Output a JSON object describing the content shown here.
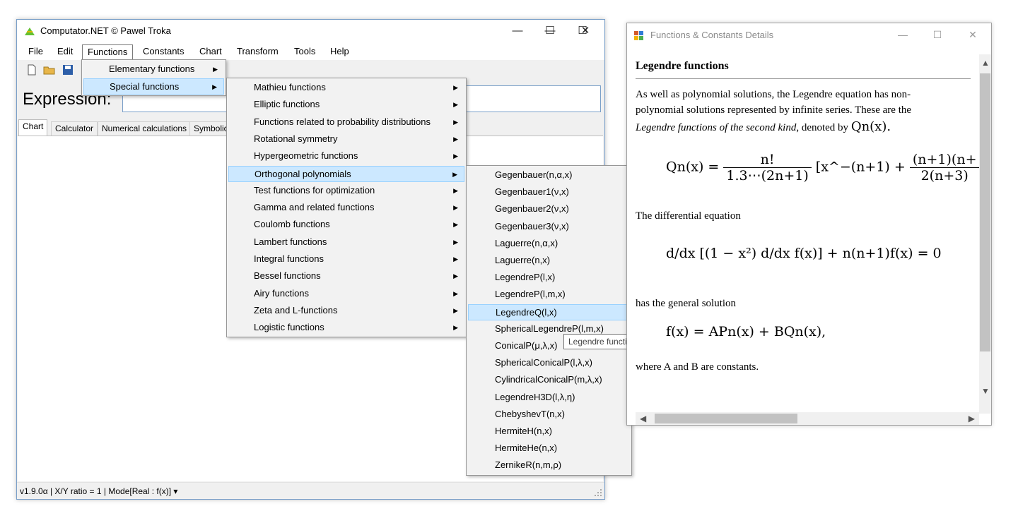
{
  "main_window": {
    "title": "Computator.NET © Pawel Troka",
    "caption": {
      "minimize": "—",
      "maximize": "☐",
      "close": "✕"
    },
    "menu": [
      "File",
      "Edit",
      "Functions",
      "Constants",
      "Chart",
      "Transform",
      "Tools",
      "Help"
    ],
    "expression_label": "Expression:",
    "tabs": [
      "Chart",
      "Calculator",
      "Numerical calculations",
      "Symbolic"
    ],
    "status": "v1.9.0α   | X/Y ratio = 1 |  Mode[Real : f(x)]  ▾"
  },
  "functions_menu": {
    "items": [
      "Elementary functions",
      "Special functions"
    ],
    "highlighted": "Special functions"
  },
  "special_functions_menu": {
    "items": [
      "Mathieu functions",
      "Elliptic functions",
      "Functions related to probability distributions",
      "Rotational symmetry",
      "Hypergeometric functions",
      "Orthogonal polynomials",
      "Test functions for optimization",
      "Gamma and related functions",
      "Coulomb functions",
      "Lambert functions",
      "Integral functions",
      "Bessel functions",
      "Airy functions",
      "Zeta and L-functions",
      "Logistic functions"
    ],
    "highlighted": "Orthogonal polynomials"
  },
  "orthogonal_menu": {
    "items": [
      "Gegenbauer(n,α,x)",
      "Gegenbauer1(ν,x)",
      "Gegenbauer2(ν,x)",
      "Gegenbauer3(ν,x)",
      "Laguerre(n,α,x)",
      "Laguerre(n,x)",
      "LegendreP(l,x)",
      "LegendreP(l,m,x)",
      "LegendreQ(l,x)",
      "SphericalLegendreP(l,m,x)",
      "ConicalP(μ,λ,x)",
      "SphericalConicalP(l,λ,x)",
      "CylindricalConicalP(m,λ,x)",
      "LegendreH3D(l,λ,η)",
      "ChebyshevT(n,x)",
      "HermiteH(n,x)",
      "HermiteHe(n,x)",
      "ZernikeR(n,m,ρ)"
    ],
    "highlighted": "LegendreQ(l,x)",
    "tooltip": "Legendre functions"
  },
  "details_window": {
    "title": "Functions & Constants Details",
    "caption": {
      "minimize": "—",
      "maximize": "☐",
      "close": "✕"
    },
    "heading": "Legendre functions",
    "para1_line1": "As well as polynomial solutions, the Legendre equation has non-",
    "para1_line2": "polynomial solutions represented by infinite series. These are the",
    "para1_line3_italic": "Legendre functions of the second kind",
    "para1_line3_rest": ", denoted by",
    "para1_symbol": "Qn(x).",
    "eq1_lhs": "Qn(x) =",
    "eq1_num": "n!",
    "eq1_den": "1.3⋯(2n+1)",
    "eq1_bracket": "[x^−(n+1) +",
    "eq1_num2": "(n+1)(n+",
    "eq1_den2": "2(n+3)",
    "para2": "The differential equation",
    "eq2": "d/dx [(1 − x²) d/dx f(x)] + n(n+1)f(x) = 0",
    "para3": "has the general solution",
    "eq3": "f(x) = APn(x) + BQn(x),",
    "para4": "where A and B are constants."
  }
}
